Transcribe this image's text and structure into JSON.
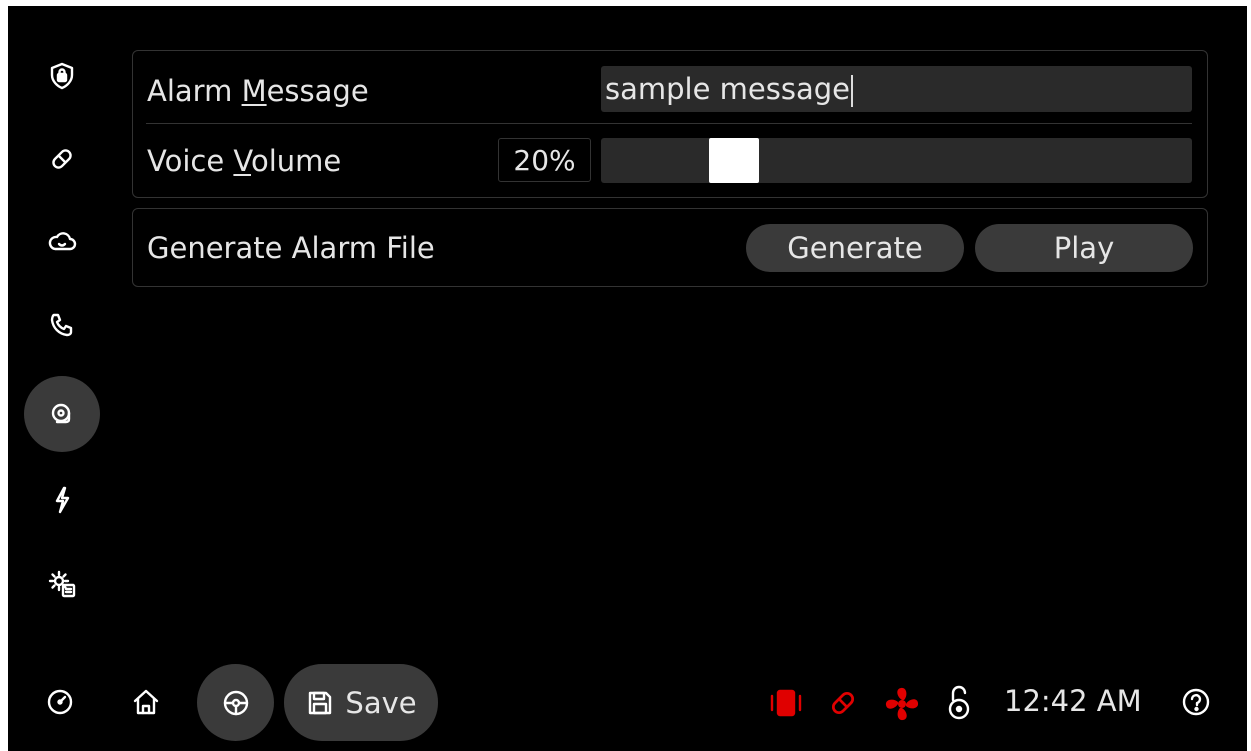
{
  "sidebar": {
    "items": [
      {
        "icon": "shield-lock-icon"
      },
      {
        "icon": "pill-icon"
      },
      {
        "icon": "cloud-icon"
      },
      {
        "icon": "phone-icon"
      },
      {
        "icon": "alarm-bell-icon",
        "active": true
      },
      {
        "icon": "lightning-icon"
      },
      {
        "icon": "settings-gear-icon"
      }
    ]
  },
  "alarm_message": {
    "label_pre": "Alarm ",
    "label_accel": "M",
    "label_post": "essage",
    "value": "sample message"
  },
  "voice_volume": {
    "label_pre": "Voice ",
    "label_accel": "V",
    "label_post": "olume",
    "value_text": "20%",
    "value": 20
  },
  "generate": {
    "label": "Generate Alarm File",
    "generate_button": "Generate",
    "play_button": "Play"
  },
  "bottom_bar": {
    "save_label": "Save",
    "time": "12:42 AM",
    "status_icons": [
      "vibration-icon",
      "pill-icon",
      "fan-icon",
      "unlock-icon"
    ],
    "status_color": "#e00000"
  }
}
